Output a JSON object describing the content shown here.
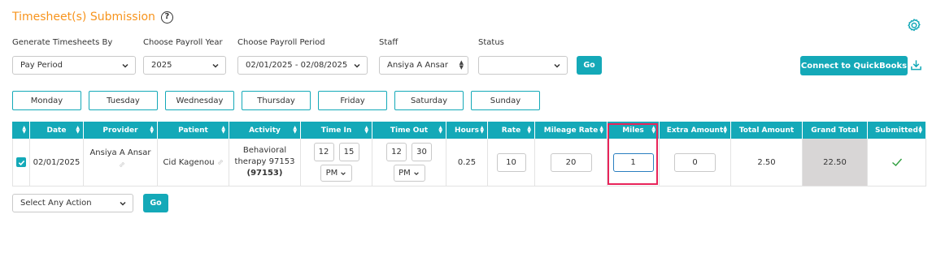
{
  "header": {
    "title": "Timesheet(s) Submission",
    "help_icon": "?"
  },
  "filters": {
    "generate_by": {
      "label": "Generate Timesheets By",
      "value": "Pay Period"
    },
    "payroll_year": {
      "label": "Choose Payroll Year",
      "value": "2025"
    },
    "payroll_period": {
      "label": "Choose Payroll Period",
      "value": "02/01/2025 - 02/08/2025"
    },
    "staff": {
      "label": "Staff",
      "value": "Ansiya A Ansar"
    },
    "status": {
      "label": "Status",
      "value": ""
    },
    "go_label": "Go",
    "quickbooks_label": "Connect to QuickBooks"
  },
  "days": [
    "Monday",
    "Tuesday",
    "Wednesday",
    "Thursday",
    "Friday",
    "Saturday",
    "Sunday"
  ],
  "table": {
    "columns": [
      "Date",
      "Provider",
      "Patient",
      "Activity",
      "Time In",
      "Time Out",
      "Hours",
      "Rate",
      "Mileage Rate",
      "Miles",
      "Extra Amount",
      "Total Amount",
      "Grand Total",
      "Submitted"
    ],
    "row": {
      "date": "02/01/2025",
      "provider": "Ansiya A Ansar",
      "patient": "Cid Kagenou",
      "activity_line1": "Behavioral",
      "activity_line2": "therapy 97153",
      "activity_code": "(97153)",
      "time_in_hour": "12",
      "time_in_min": "15",
      "time_in_ampm": "PM",
      "time_out_hour": "12",
      "time_out_min": "30",
      "time_out_ampm": "PM",
      "hours": "0.25",
      "rate": "10",
      "mileage_rate": "20",
      "miles": "1",
      "extra_amount": "0",
      "total_amount": "2.50",
      "grand_total": "22.50",
      "submitted": "✓"
    }
  },
  "bulk_action": {
    "value": "Select Any Action",
    "go_label": "Go"
  },
  "colors": {
    "accent": "#14a9b8",
    "title": "#f7941d",
    "highlight": "#e8245a",
    "grand_total_bg": "#d8d6d6",
    "check": "#2e9e3e"
  }
}
